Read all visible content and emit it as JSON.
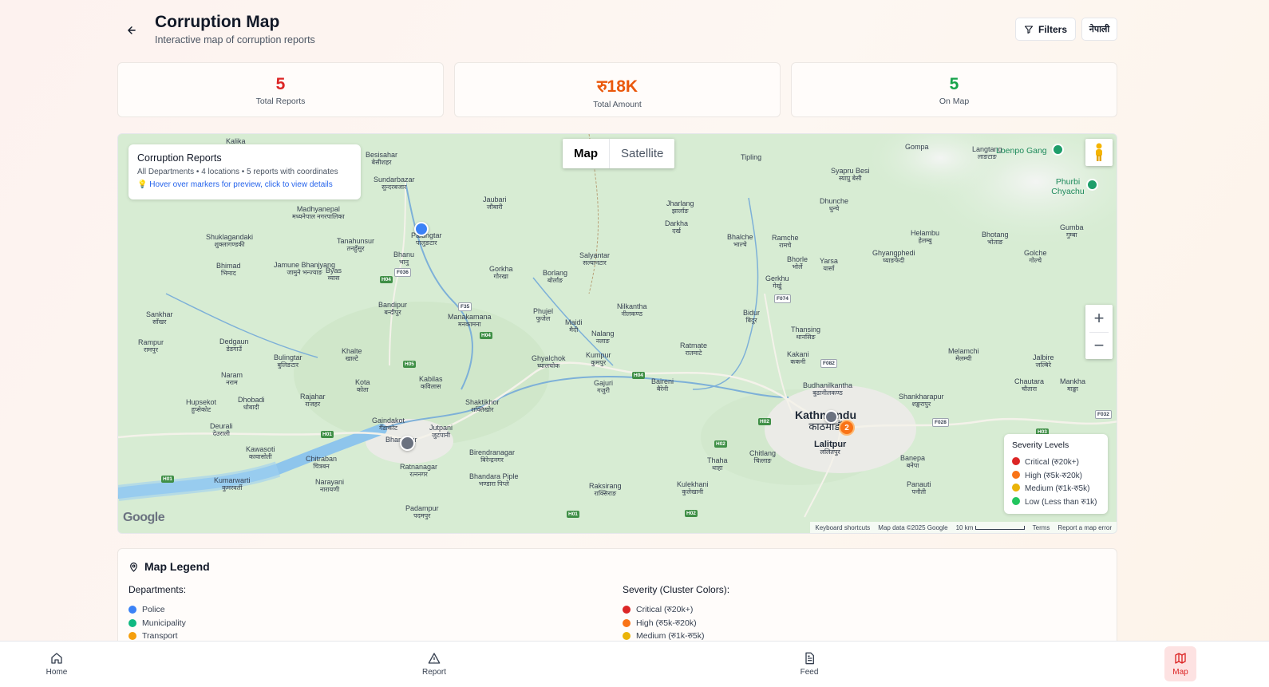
{
  "header": {
    "title": "Corruption Map",
    "subtitle": "Interactive map of corruption reports",
    "filters_label": "Filters",
    "language_label": "नेपाली"
  },
  "stats": [
    {
      "value": "5",
      "label": "Total Reports",
      "color": "#dc2626"
    },
    {
      "value": "रु18K",
      "label": "Total Amount",
      "color": "#ea580c"
    },
    {
      "value": "5",
      "label": "On Map",
      "color": "#16a34a"
    }
  ],
  "map": {
    "info": {
      "title": "Corruption Reports",
      "subtitle": "All Departments • 4 locations • 5 reports with coordinates",
      "hint": "💡 Hover over markers for preview, click to view details"
    },
    "map_type": {
      "map": "Map",
      "satellite": "Satellite"
    },
    "cluster_count": "2",
    "places": [
      {
        "name": "Kalika",
        "n": ""
      },
      {
        "name": "Besisahar",
        "n": "बेसीशहर"
      },
      {
        "name": "Sundarbazar",
        "n": "सुन्दरबजार"
      },
      {
        "name": "Jaubari",
        "n": "जौबारी"
      },
      {
        "name": "Tipling",
        "n": ""
      },
      {
        "name": "Syapru Besi",
        "n": "स्याप्रु बेसी"
      },
      {
        "name": "Gompa",
        "n": ""
      },
      {
        "name": "Langtang",
        "n": "लाङटाङ"
      },
      {
        "name": "Loenpo Gang",
        "n": ""
      },
      {
        "name": "Phurbi Chyachu",
        "n": ""
      },
      {
        "name": "Madhyanepal",
        "n": "मध्यनेपाल नगरपालिका"
      },
      {
        "name": "Palungtar",
        "n": "पालुङटार"
      },
      {
        "name": "Jharlang",
        "n": "झार्लाङ"
      },
      {
        "name": "Darkha",
        "n": "दर्ख"
      },
      {
        "name": "Dhunche",
        "n": "धुन्चे"
      },
      {
        "name": "Shuklagandaki",
        "n": "शुक्लागण्डकी"
      },
      {
        "name": "Tanahunsur",
        "n": "तनहुँसुर"
      },
      {
        "name": "Bhalche",
        "n": "भाल्चे"
      },
      {
        "name": "Ramche",
        "n": "रामचे"
      },
      {
        "name": "Helambu",
        "n": "हेलम्बु"
      },
      {
        "name": "Bhotang",
        "n": "भोताङ"
      },
      {
        "name": "Gumba",
        "n": "गुम्बा"
      },
      {
        "name": "Bhanu",
        "n": "भानु"
      },
      {
        "name": "Bhimad",
        "n": "भिमाद"
      },
      {
        "name": "Jamune Bhanjyang",
        "n": "जामुने भन्ज्याङ"
      },
      {
        "name": "Byas",
        "n": "व्यास"
      },
      {
        "name": "Gorkha",
        "n": "गोरखा"
      },
      {
        "name": "Borlang",
        "n": "बोर्लाङ"
      },
      {
        "name": "Salyantar",
        "n": "सल्यानटार"
      },
      {
        "name": "Bhorle",
        "n": "भोर्ले"
      },
      {
        "name": "Yarsa",
        "n": "यार्सा"
      },
      {
        "name": "Ghyangphedi",
        "n": "घ्याङफेदी"
      },
      {
        "name": "Golche",
        "n": "गोल्चे"
      },
      {
        "name": "Gerkhu",
        "n": "गेर्खु"
      },
      {
        "name": "Bandipur",
        "n": "बन्दीपुर"
      },
      {
        "name": "Sankhar",
        "n": "साँखर"
      },
      {
        "name": "Manakamana",
        "n": "मनकामना"
      },
      {
        "name": "Phujel",
        "n": "फुजेल"
      },
      {
        "name": "Maidi",
        "n": "मैदी"
      },
      {
        "name": "Nilkantha",
        "n": "नीलकण्ठ"
      },
      {
        "name": "Bidur",
        "n": "बिदुर"
      },
      {
        "name": "Rampur",
        "n": "रामपुर"
      },
      {
        "name": "Dedgaun",
        "n": "डेडगाउँ"
      },
      {
        "name": "Nalang",
        "n": "नलाङ"
      },
      {
        "name": "Thansing",
        "n": "थानसिङ"
      },
      {
        "name": "Bulingtar",
        "n": "बुलिङटार"
      },
      {
        "name": "Khalte",
        "n": "खाल्टे"
      },
      {
        "name": "Ghyalchok",
        "n": "घ्यालचोक"
      },
      {
        "name": "Kumpur",
        "n": "कुमपुर"
      },
      {
        "name": "Ratmate",
        "n": "रातमाटे"
      },
      {
        "name": "Kakani",
        "n": "ककनी"
      },
      {
        "name": "Melamchi",
        "n": "मेलम्ची"
      },
      {
        "name": "Jalbire",
        "n": "जल्बिरे"
      },
      {
        "name": "Naram",
        "n": "नराम"
      },
      {
        "name": "Kota",
        "n": "कोता"
      },
      {
        "name": "Kabilas",
        "n": "कविलास"
      },
      {
        "name": "Gajuri",
        "n": "गजुरी"
      },
      {
        "name": "Baireni",
        "n": "बैरेनी"
      },
      {
        "name": "Budhanilkantha",
        "n": "बुढानीलकण्ठ"
      },
      {
        "name": "Chautara",
        "n": "चौतारा"
      },
      {
        "name": "Mankha",
        "n": "माङ्खा"
      },
      {
        "name": "Hupsekot",
        "n": "हुप्सेकोट"
      },
      {
        "name": "Dhobadi",
        "n": "धोबादी"
      },
      {
        "name": "Rajahar",
        "n": "राजहर"
      },
      {
        "name": "Shaktikhor",
        "n": "शक्तिखोर"
      },
      {
        "name": "Shankharapur",
        "n": "शङ्खरापुर"
      },
      {
        "name": "Gaindakot",
        "n": "गैँडाकोट"
      },
      {
        "name": "Jutpani",
        "n": "जुटपानी"
      },
      {
        "name": "Deurali",
        "n": "देउराली"
      },
      {
        "name": "Bharatpur",
        "n": ""
      },
      {
        "name": "Lalitpur",
        "n": "ललितपुर"
      },
      {
        "name": "Kawasoti",
        "n": "कावासोती"
      },
      {
        "name": "Birendranagar",
        "n": "बिरेन्द्रनगर"
      },
      {
        "name": "Chitlang",
        "n": "चित्लाङ"
      },
      {
        "name": "Thaha",
        "n": "थाहा"
      },
      {
        "name": "Banepa",
        "n": "बनेपा"
      },
      {
        "name": "Chitraban",
        "n": "चित्रबन"
      },
      {
        "name": "Ratnanagar",
        "n": "रत्ननगर"
      },
      {
        "name": "Kumarwarti",
        "n": "कुमरवर्ती"
      },
      {
        "name": "Bhandara Piple",
        "n": "भण्डारा पिप्ले"
      },
      {
        "name": "Raksirang",
        "n": "राक्सिराङ"
      },
      {
        "name": "Kulekhani",
        "n": "कुलेखानी"
      },
      {
        "name": "Panauti",
        "n": "पनौती"
      },
      {
        "name": "Narayani",
        "n": "नारायणी"
      },
      {
        "name": "Padampur",
        "n": "पदमपुर"
      },
      {
        "name": "Kathmandu",
        "n": "काठमाडौं"
      }
    ],
    "roads": [
      "H04",
      "F036",
      "F35",
      "H04",
      "H05",
      "H04",
      "F074",
      "F082",
      "H02",
      "H02",
      "F028",
      "H03",
      "F032",
      "H01",
      "H01",
      "H01",
      "H02"
    ],
    "attribution": {
      "shortcuts": "Keyboard shortcuts",
      "data": "Map data ©2025 Google",
      "scale": "10 km",
      "terms": "Terms",
      "report": "Report a map error",
      "logo": "Google"
    },
    "severity": {
      "title": "Severity Levels",
      "items": [
        {
          "label": "Critical (रु20k+)",
          "color": "#dc2626"
        },
        {
          "label": "High (रु5k-रु20k)",
          "color": "#f97316"
        },
        {
          "label": "Medium (रु1k-रु5k)",
          "color": "#eab308"
        },
        {
          "label": "Low (Less than रु1k)",
          "color": "#22c55e"
        }
      ]
    }
  },
  "legend": {
    "title": "Map Legend",
    "departments_title": "Departments:",
    "departments": [
      {
        "label": "Police",
        "color": "#3b82f6"
      },
      {
        "label": "Municipality",
        "color": "#10b981"
      },
      {
        "label": "Transport",
        "color": "#f59e0b"
      }
    ],
    "severity_title": "Severity (Cluster Colors):",
    "severity": [
      {
        "label": "Critical (रु20k+)",
        "color": "#dc2626"
      },
      {
        "label": "High (रु5k-रु20k)",
        "color": "#f97316"
      },
      {
        "label": "Medium (रु1k-रु5k)",
        "color": "#eab308"
      }
    ]
  },
  "nav": [
    {
      "label": "Home",
      "icon": "home-icon"
    },
    {
      "label": "Report",
      "icon": "alert-triangle-icon"
    },
    {
      "label": "Feed",
      "icon": "document-icon"
    },
    {
      "label": "Map",
      "icon": "map-icon"
    }
  ]
}
